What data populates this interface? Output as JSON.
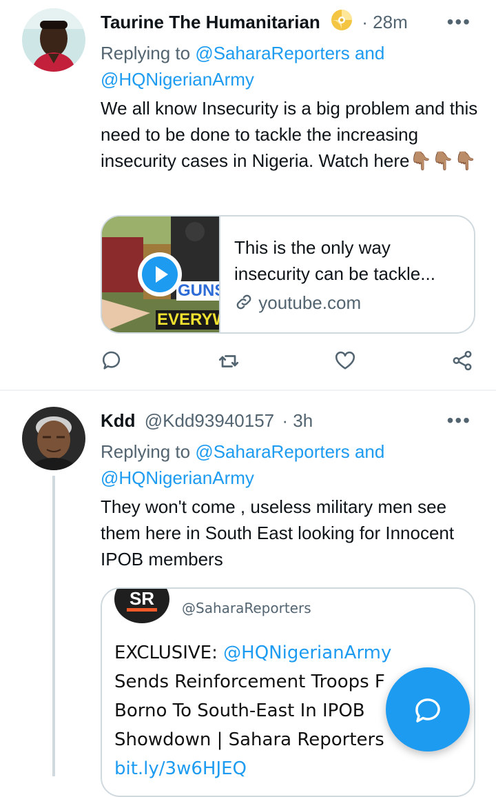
{
  "tweets": [
    {
      "author_name": "Taurine The Humanitarian",
      "badge_icon": "cd-disc-emoji",
      "timestamp": "· 28m",
      "more_label": "•••",
      "replying_prefix": "Replying to",
      "replying_user1": "@SaharaReporters",
      "replying_and": "and",
      "replying_user2": "@HQNigerianArmy",
      "text": "We all know Insecurity is a big problem and this need to be done to tackle the increasing insecurity cases in Nigeria. Watch here",
      "emoji": "👇🏽👇🏽👇🏽",
      "card": {
        "title": "This is the only way insecurity can be tackle...",
        "domain": "youtube.com",
        "thumb_text_line1": "GUNS",
        "thumb_text_line2": "EVERYW"
      }
    },
    {
      "author_name": "Kdd",
      "handle": "@Kdd93940157",
      "timestamp": "· 3h",
      "more_label": "•••",
      "replying_prefix": "Replying to",
      "replying_user1": "@SaharaReporters",
      "replying_and": "and",
      "replying_user2": "@HQNigerianArmy",
      "text": "They won't come , useless military men see them here in South East looking for Innocent IPOB members",
      "image": {
        "logo_text": "SR",
        "handle": "@SaharaReporters",
        "headline_prefix": "EXCLUSIVE:",
        "headline_mention": "@HQNigerianArmy",
        "headline_line2": "Sends Reinforcement Troops F",
        "headline_line3": "Borno To South-East In IPOB",
        "headline_line4": "Showdown | Sahara Reporters",
        "link": "bit.ly/3w6HJEQ"
      }
    }
  ],
  "colors": {
    "accent": "#1d9bf0",
    "muted": "#536471",
    "border": "#cfd9de"
  }
}
